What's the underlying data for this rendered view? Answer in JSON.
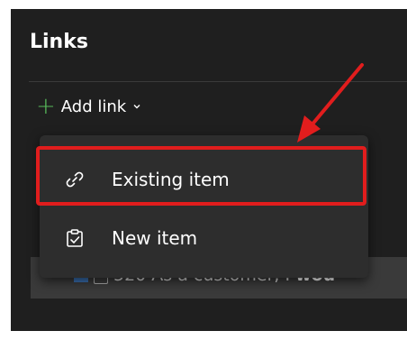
{
  "links": {
    "title": "Links",
    "add_link_label": "Add link",
    "menu": {
      "existing_item_label": "Existing item",
      "new_item_label": "New item"
    },
    "background_row": {
      "id_text": "520 As a customer, I",
      "bold_text": "wou"
    }
  },
  "icons": {
    "add": "plus-icon",
    "dropdown": "chevron-down-icon",
    "existing": "link-icon",
    "new": "clipboard-check-icon"
  },
  "colors": {
    "accent_green": "#57b85a",
    "highlight_red": "#e11d1d",
    "panel_bg": "#1f1f1f",
    "menu_bg": "#2d2d2d"
  }
}
